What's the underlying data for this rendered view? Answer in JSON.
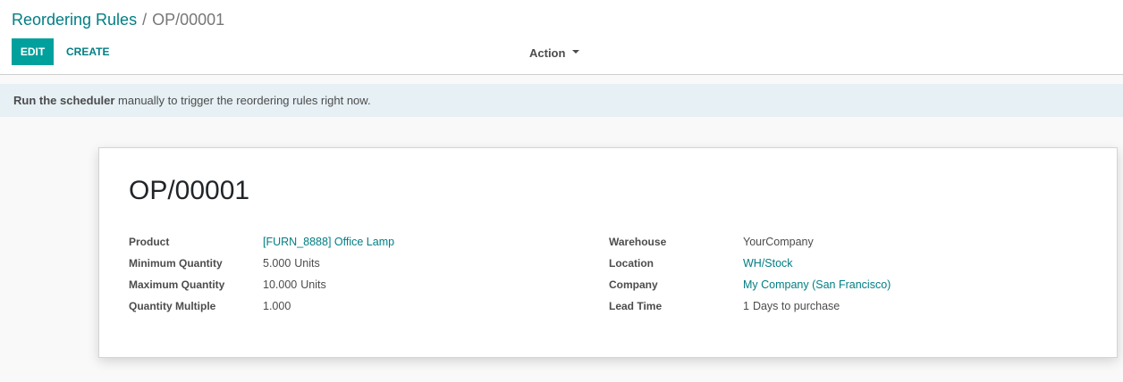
{
  "breadcrumb": {
    "parent": "Reordering Rules",
    "separator": "/",
    "current": "OP/00001"
  },
  "toolbar": {
    "edit_label": "EDIT",
    "create_label": "CREATE",
    "action_label": "Action"
  },
  "alert": {
    "link_text": "Run the scheduler",
    "text": " manually to trigger the reordering rules right now."
  },
  "record": {
    "title": "OP/00001",
    "left_fields": [
      {
        "label": "Product",
        "value": "[FURN_8888] Office Lamp",
        "unit": ""
      },
      {
        "label": "Minimum Quantity",
        "value": "5.000",
        "unit": "Units"
      },
      {
        "label": "Maximum Quantity",
        "value": "10.000",
        "unit": "Units"
      },
      {
        "label": "Quantity Multiple",
        "value": "1.000",
        "unit": ""
      }
    ],
    "right_fields": [
      {
        "label": "Warehouse",
        "value": "YourCompany",
        "unit": ""
      },
      {
        "label": "Location",
        "value": "WH/Stock",
        "unit": ""
      },
      {
        "label": "Company",
        "value": "My Company (San Francisco)",
        "unit": ""
      },
      {
        "label": "Lead Time",
        "value": "1",
        "unit": "Days to purchase"
      }
    ]
  },
  "colors": {
    "accent": "#00a09d",
    "link": "#017e84",
    "alert_bg": "#e6f0f5"
  }
}
